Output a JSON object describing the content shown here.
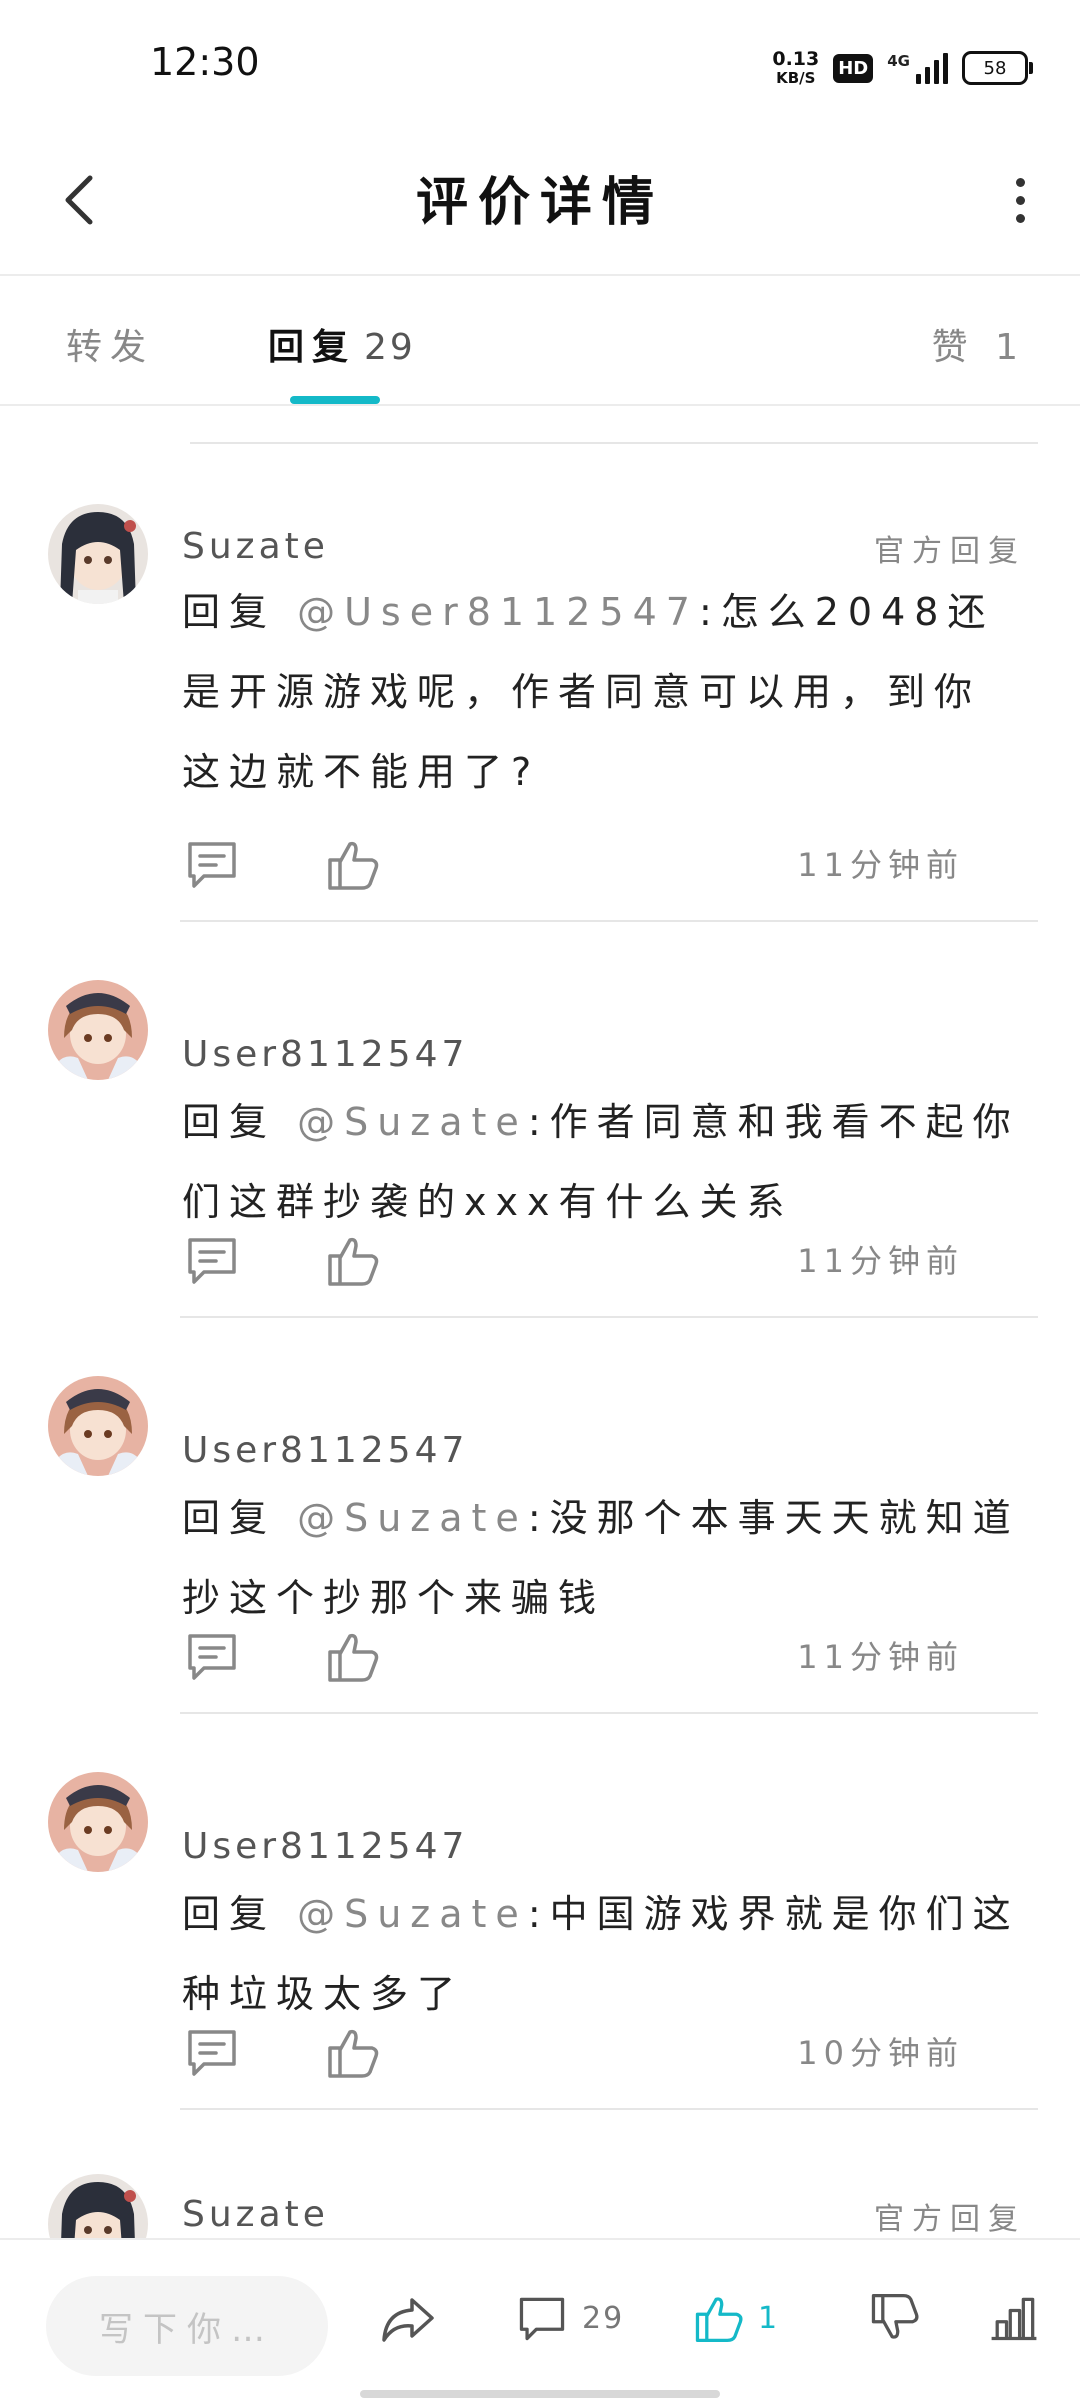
{
  "status_bar": {
    "time": "12:30",
    "net_speed": "0.13",
    "net_unit": "KB/S",
    "hd": "HD",
    "signal": "4G",
    "battery": "58"
  },
  "header": {
    "title": "评价详情",
    "back_icon": "chevron-left-icon",
    "more_icon": "more-vertical-icon"
  },
  "tabs": {
    "forward": "转发",
    "reply": "回复",
    "reply_count": "29",
    "likes": "赞 1"
  },
  "comments": [
    {
      "name": "Suzate",
      "official": "官方回复",
      "prefix": "回复 ",
      "mention": "@User8112547",
      "text": ":怎么2048还是开源游戏呢，作者同意可以用，到你这边就不能用了?",
      "time": "11分钟前",
      "avatar": "dark-haired-girl"
    },
    {
      "name": "User8112547",
      "official": "",
      "prefix": "回复 ",
      "mention": "@Suzate",
      "text": ":作者同意和我看不起你们这群抄袭的xxx有什么关系",
      "time": "11分钟前",
      "avatar": "brown-haired-girl"
    },
    {
      "name": "User8112547",
      "official": "",
      "prefix": "回复 ",
      "mention": "@Suzate",
      "text": ":没那个本事天天就知道抄这个抄那个来骗钱",
      "time": "11分钟前",
      "avatar": "brown-haired-girl"
    },
    {
      "name": "User8112547",
      "official": "",
      "prefix": "回复 ",
      "mention": "@Suzate",
      "text": ":中国游戏界就是你们这种垃圾太多了",
      "time": "10分钟前",
      "avatar": "brown-haired-girl"
    },
    {
      "name": "Suzate",
      "official": "官方回复",
      "prefix": "",
      "mention": "",
      "text": "",
      "time": "",
      "avatar": "dark-haired-girl"
    }
  ],
  "bottom_bar": {
    "input_placeholder": "写下你…",
    "comment_count": "29",
    "like_count": "1",
    "accent": "#14b9c8"
  }
}
